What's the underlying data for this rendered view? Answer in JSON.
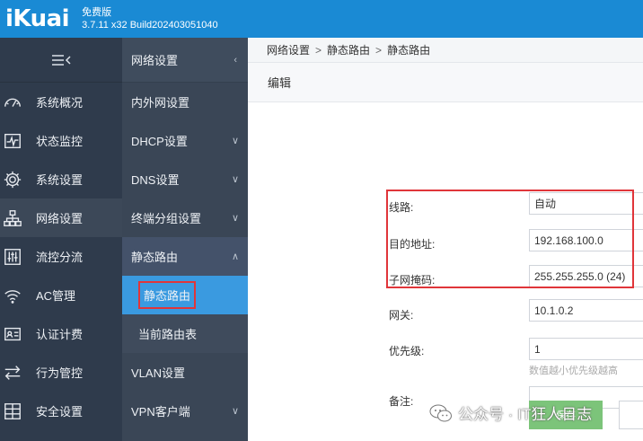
{
  "header": {
    "logo": "iKuai",
    "edition": "免费版",
    "build": "3.7.11 x32 Build202403051040"
  },
  "sidebar": {
    "toggle": "☰‹",
    "items": [
      {
        "label": "系统概况",
        "icon": "dashboard-icon"
      },
      {
        "label": "状态监控",
        "icon": "monitor-icon"
      },
      {
        "label": "系统设置",
        "icon": "gear-icon"
      },
      {
        "label": "网络设置",
        "icon": "network-icon"
      },
      {
        "label": "流控分流",
        "icon": "sliders-icon"
      },
      {
        "label": "AC管理",
        "icon": "wifi-icon"
      },
      {
        "label": "认证计费",
        "icon": "id-card-icon"
      },
      {
        "label": "行为管控",
        "icon": "arrows-icon"
      },
      {
        "label": "安全设置",
        "icon": "shield-grid-icon"
      }
    ]
  },
  "submenu": {
    "title": "网络设置",
    "items": [
      {
        "label": "内外网设置"
      },
      {
        "label": "DHCP设置"
      },
      {
        "label": "DNS设置"
      },
      {
        "label": "终端分组设置"
      },
      {
        "label": "静态路由"
      }
    ],
    "children": [
      {
        "label": "静态路由"
      },
      {
        "label": "当前路由表"
      }
    ],
    "after": [
      {
        "label": "VLAN设置"
      },
      {
        "label": "VPN客户端"
      }
    ]
  },
  "breadcrumb": {
    "a": "网络设置",
    "sep": ">",
    "b": "静态路由",
    "c": "静态路由"
  },
  "panel": {
    "title": "编辑"
  },
  "form": {
    "line_label": "线路:",
    "line_value": "自动",
    "dest_label": "目的地址:",
    "dest_value": "192.168.100.0",
    "mask_label": "子网掩码:",
    "mask_value": "255.255.255.0 (24)",
    "gw_label": "网关:",
    "gw_value": "10.1.0.2",
    "prio_label": "优先级:",
    "prio_value": "1",
    "prio_hint": "数值越小优先级越高",
    "note_label": "备注:",
    "note_value": "",
    "save_label": "保存"
  },
  "watermark": {
    "text": "公众号 · IT狂人日志"
  },
  "colors": {
    "header": "#1a8ad4",
    "sidebar": "#2f3b4c",
    "selected": "#3a9ae0",
    "highlight": "#e0353a"
  }
}
